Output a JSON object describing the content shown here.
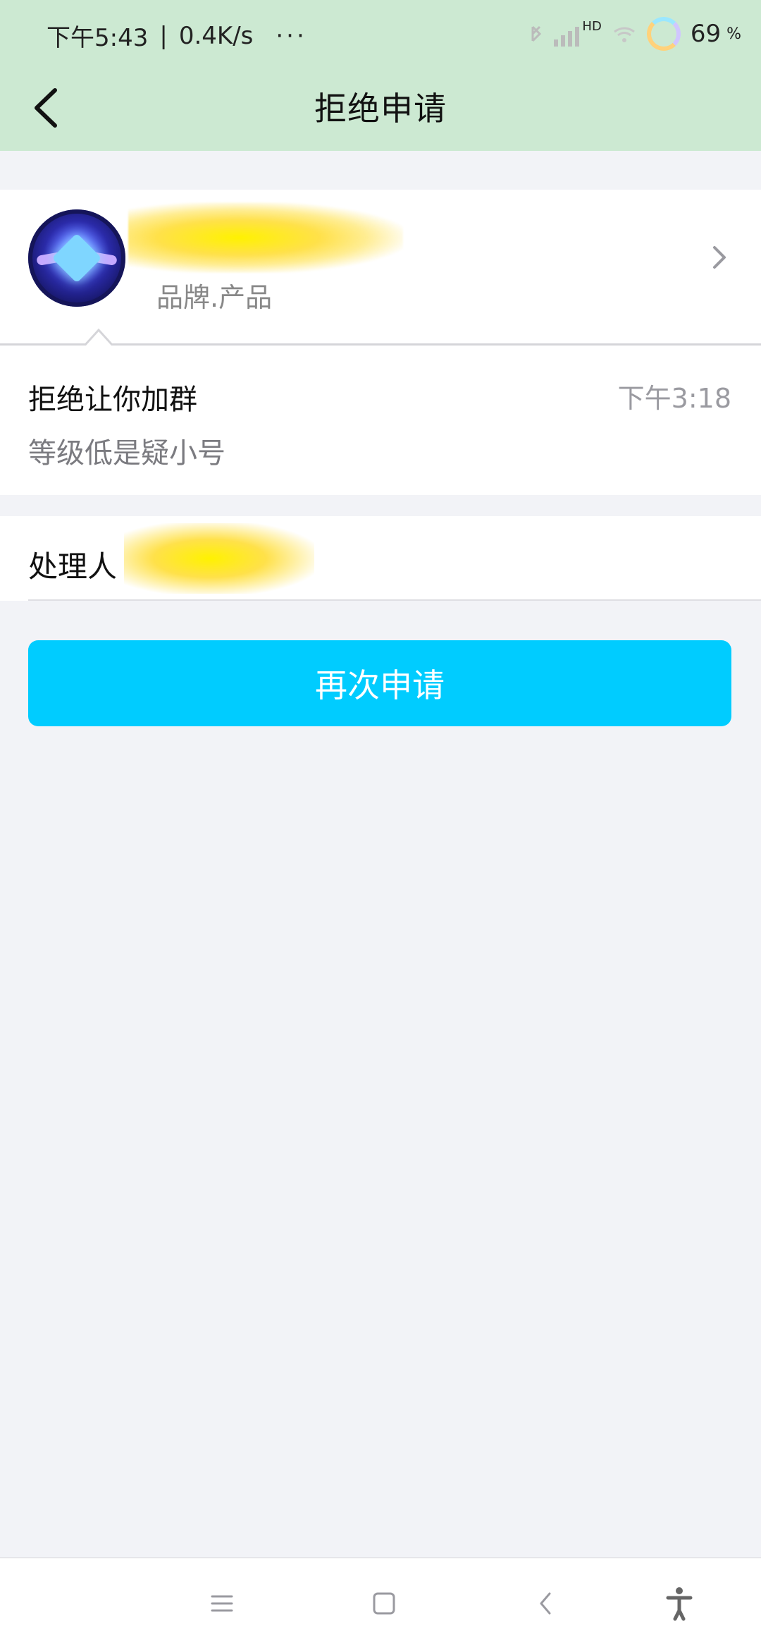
{
  "status_bar": {
    "time_text": "下午5:43",
    "speed_text": "0.4K/s",
    "more_dots": "···",
    "battery": "69",
    "battery_suffix": "%",
    "hd_label": "HD"
  },
  "title_bar": {
    "title": "拒绝申请"
  },
  "profile": {
    "subtitle": "品牌.产品"
  },
  "message": {
    "heading": "拒绝让你加群",
    "time": "下午3:18",
    "reason": "等级低是疑小号"
  },
  "handler": {
    "label": "处理人"
  },
  "actions": {
    "reapply_label": "再次申请"
  },
  "colors": {
    "top_bg": "#cce9d2",
    "page_bg": "#f2f3f7",
    "primary": "#00ccff"
  },
  "icons": {
    "back": "chevron-left-icon",
    "forward": "chevron-right-icon",
    "menu": "menu-icon",
    "home": "square-icon",
    "nav_back": "triangle-back-icon",
    "accessibility": "accessibility-icon"
  }
}
